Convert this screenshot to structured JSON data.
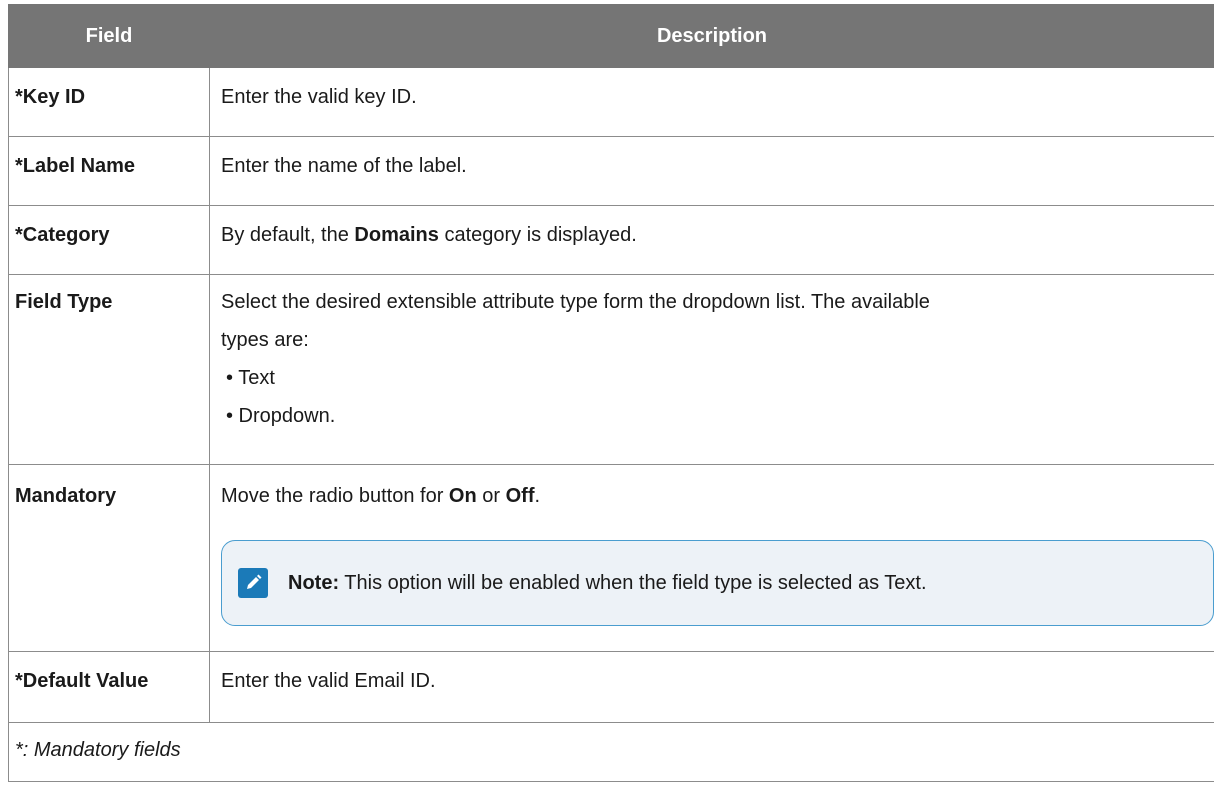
{
  "table": {
    "headers": {
      "field": "Field",
      "description": "Description"
    },
    "rows": [
      {
        "field": "*Key ID",
        "description": "Enter the valid key ID."
      },
      {
        "field": "*Label Name",
        "description": "Enter the name of the label."
      },
      {
        "field": "*Category",
        "description_pre": "By default, the ",
        "description_bold": "Domains",
        "description_post": " category is displayed."
      },
      {
        "field": "Field Type",
        "description_line1": "Select the desired extensible attribute type form the dropdown list. The available",
        "description_line2": "types are:",
        "bullets": [
          "• Text",
          "• Dropdown."
        ]
      },
      {
        "field": "Mandatory",
        "description_pre": "Move the radio button for ",
        "on_label": "On",
        "or_text": " or ",
        "off_label": "Off",
        "description_post": ".",
        "note_label": "Note:",
        "note_text": " This option will be enabled when the field type is selected as Text."
      },
      {
        "field": "*Default Value",
        "description": "Enter the valid Email ID."
      }
    ],
    "footnote": "*: Mandatory fields"
  },
  "colors": {
    "header_bg": "#757575",
    "note_border": "#4a9dcf",
    "note_bg": "#edf2f7",
    "note_icon": "#1b7ab8"
  },
  "icons": {
    "note": "note-edit-icon"
  }
}
